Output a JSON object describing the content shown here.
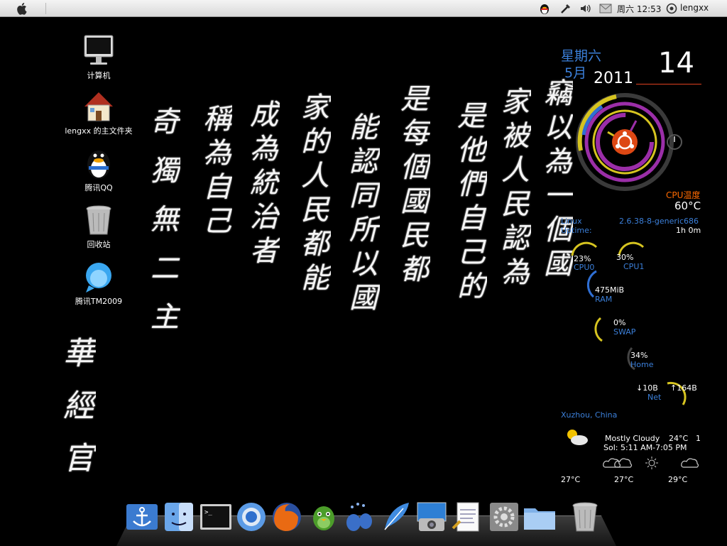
{
  "menubar": {
    "clock": "周六 12:53",
    "user": "lengxx",
    "icons": [
      "apple-icon",
      "qq-tray-icon",
      "network-tool-icon",
      "volume-icon",
      "mail-icon",
      "user-icon"
    ]
  },
  "desktop_icons": [
    {
      "name": "computer",
      "label": "计算机"
    },
    {
      "name": "home-folder",
      "label": "lengxx 的主文件夹"
    },
    {
      "name": "tencent-qq",
      "label": "腾讯QQ"
    },
    {
      "name": "trash",
      "label": "回收站"
    },
    {
      "name": "tencent-tm",
      "label": "腾讯TM2009"
    }
  ],
  "wallpaper": {
    "columns": [
      "竊以為一個國",
      "家被人民認為",
      "是他們自己的",
      "是每個國民都",
      "能認同所以國",
      "家的人民都能",
      "成為統治者",
      "稱為自己",
      "奇 獨 無 二 主",
      "華 經 官"
    ]
  },
  "calendar": {
    "weekday": "星期六",
    "month": "5月",
    "year": "2011",
    "day": "14"
  },
  "system": {
    "cpu_temp_label": "CPU温度",
    "cpu_temp": "60°C",
    "os_label": "Linux",
    "kernel": "2.6.38-8-generic686",
    "uptime_label": "Uptime:",
    "uptime": "1h 0m",
    "cpu0_pct": "23%",
    "cpu0_label": "CPU0",
    "cpu1_pct": "30%",
    "cpu1_label": "CPU1",
    "ram_value": "475MiB",
    "ram_label": "RAM",
    "swap_pct": "0%",
    "swap_label": "SWAP",
    "home_pct": "34%",
    "home_label": "Home",
    "net_down": "↓10B",
    "net_up": "↑164B",
    "net_label": "Net",
    "location": "Xuzhou, China"
  },
  "weather": {
    "condition": "Mostly Cloudy",
    "temp": "24°C",
    "extra": "1",
    "sun": "Sol: 5:11 AM-7:05 PM",
    "forecast": [
      {
        "icon": "cloudy-icon",
        "temp": "27°C"
      },
      {
        "icon": "cloudy-icon",
        "temp": "27°C"
      },
      {
        "icon": "sunny-icon",
        "temp": "29°C"
      },
      {
        "icon": "cloudy-icon",
        "temp": ""
      }
    ]
  },
  "dock": [
    "anchor",
    "finder",
    "terminal",
    "chromium",
    "firefox",
    "pidgin",
    "empathy",
    "feather",
    "photo",
    "editor",
    "settings",
    "folder",
    "trash"
  ],
  "colors": {
    "blue_text": "#3b7fd9",
    "orange_text": "#ff6a00",
    "ubuntu_orange": "#dd4814",
    "ring_purple": "#9b2ea8",
    "ring_yellow": "#d6c420",
    "ring_blue": "#2f6fd4"
  }
}
